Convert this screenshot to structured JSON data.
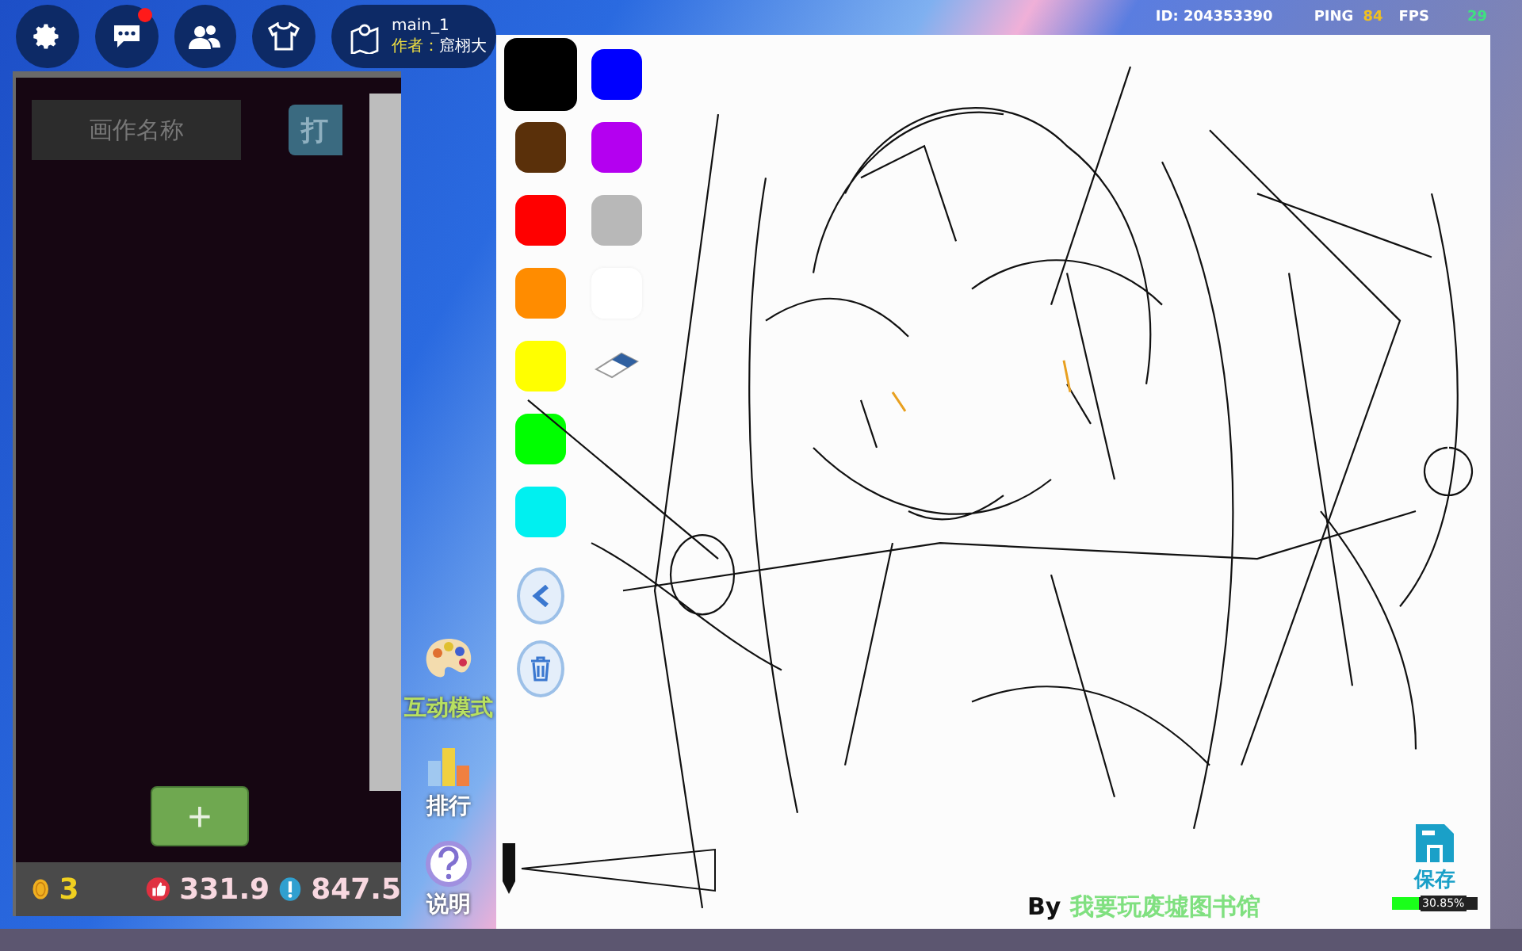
{
  "topbar": {
    "chat_unread": true,
    "map_name": "main_1",
    "author_label": "作者：",
    "author": "窟栩大"
  },
  "status": {
    "id": "ID: 204353390",
    "ping_label": "PING",
    "ping": "84",
    "fps_label": "FPS",
    "fps": "29"
  },
  "panel": {
    "name_placeholder": "画作名称",
    "open_button": "打",
    "add_button": "+"
  },
  "stats": {
    "coins": "3",
    "likes": "331.9",
    "score": "847.5"
  },
  "side": [
    {
      "kind": "palette",
      "label": "互动模式"
    },
    {
      "kind": "ranking",
      "label": "排行"
    },
    {
      "kind": "help",
      "label": "说明"
    }
  ],
  "palette": [
    {
      "color": "#000000",
      "selected": true
    },
    {
      "color": "#5a300a",
      "selected": false
    },
    {
      "color": "#ff0000",
      "selected": false
    },
    {
      "color": "#ff8c00",
      "selected": false
    },
    {
      "color": "#ffff00",
      "selected": false
    },
    {
      "color": "#00ff00",
      "selected": false
    },
    {
      "color": "#00f0f0",
      "selected": false
    },
    {
      "color": "#0000ff",
      "selected": false
    },
    {
      "color": "#b400f0",
      "selected": false
    },
    {
      "color": "#b8b8b8",
      "selected": false
    },
    {
      "color": "#ffffff",
      "selected": false
    },
    {
      "kind": "eraser",
      "selected": false
    }
  ],
  "signature": {
    "by": "By",
    "name": "我要玩废墟图书馆"
  },
  "save": {
    "label": "保存",
    "level": 0.3085,
    "reading": "30.85%"
  }
}
